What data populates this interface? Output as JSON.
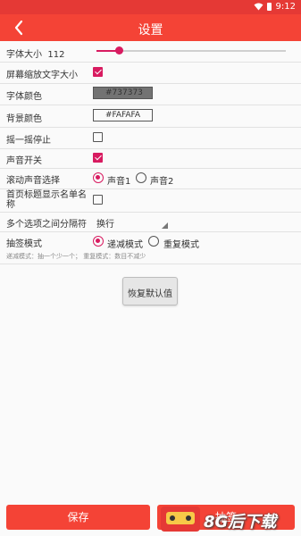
{
  "status_bar": {
    "time": "9:12"
  },
  "app_bar": {
    "title": "设置"
  },
  "settings": {
    "font_size": {
      "label": "字体大小",
      "value": "112",
      "slider_fraction": 0.12
    },
    "screen_scale_font": {
      "label": "屏幕缩放文字大小",
      "checked": true
    },
    "font_color": {
      "label": "字体颜色",
      "value": "#737373",
      "swatch": "#737373"
    },
    "bg_color": {
      "label": "背景颜色",
      "value": "#FAFAFA",
      "swatch": "#FAFAFA"
    },
    "shake_stop": {
      "label": "摇一摇停止",
      "checked": false
    },
    "sound_switch": {
      "label": "声音开关",
      "checked": true
    },
    "scroll_sound": {
      "label": "滚动声音选择",
      "options": [
        "声音1",
        "声音2"
      ],
      "selected": 0
    },
    "home_title": {
      "label": "首页标题显示名单名称",
      "checked": false
    },
    "separator": {
      "label": "多个选项之间分隔符",
      "value": "换行"
    },
    "draw_mode": {
      "label": "抽签模式",
      "options": [
        "递减模式",
        "重复模式"
      ],
      "selected": 0,
      "hint": "递减模式：抽一个少一个；  重复模式：数目不减少"
    }
  },
  "restore_button": "恢复默认值",
  "save_button": "保存",
  "second_button": "抽签",
  "watermark": "8G后下载",
  "colors": {
    "primary": "#f44336",
    "status": "#e53935",
    "accent": "#d81b60"
  }
}
